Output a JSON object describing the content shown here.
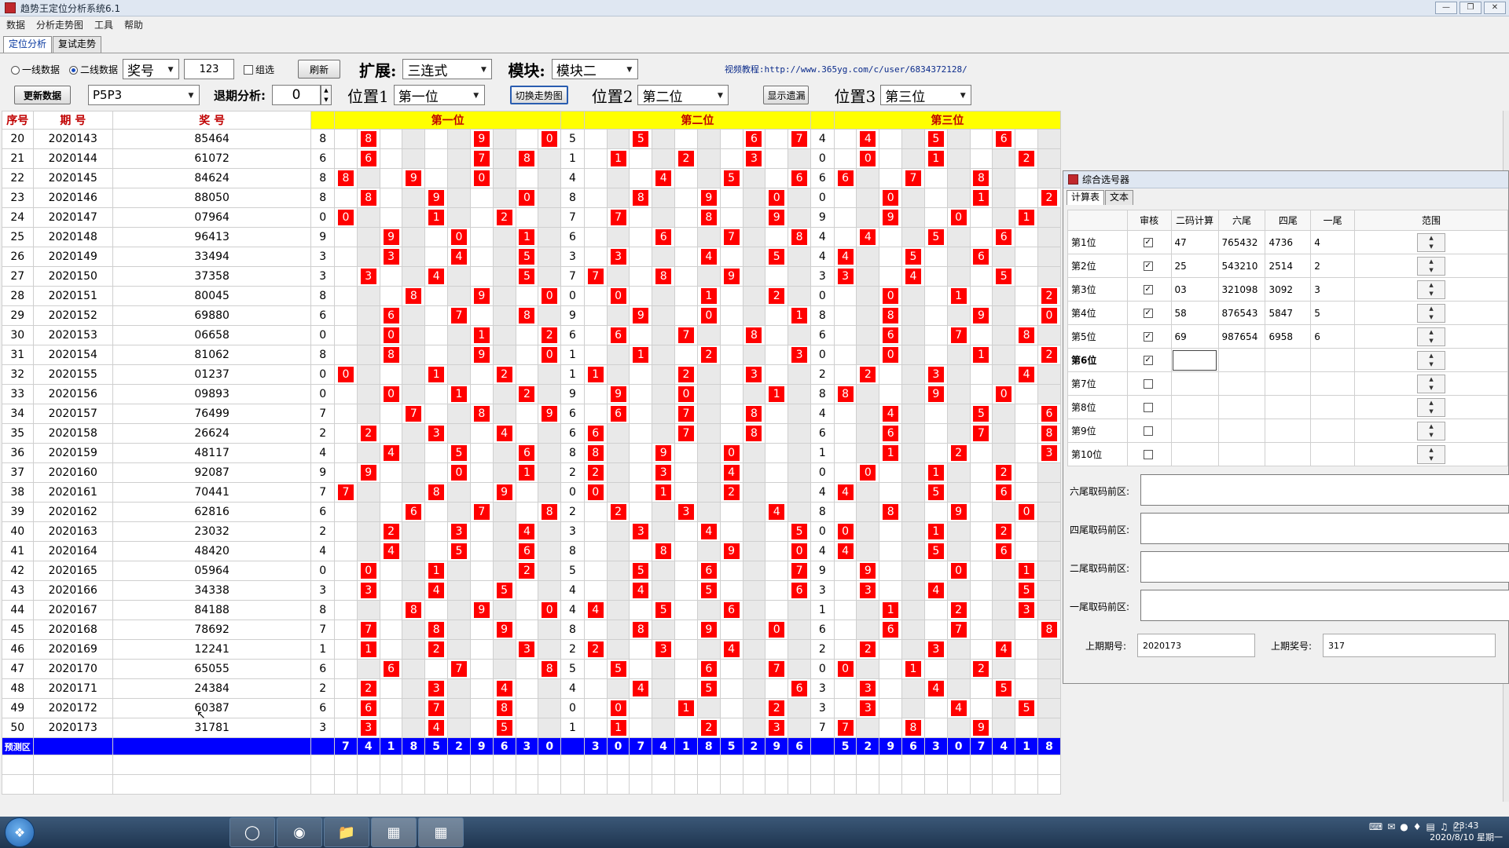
{
  "window": {
    "title": "趋势王定位分析系统6.1",
    "menu": [
      "数据",
      "分析走势图",
      "工具",
      "帮助"
    ],
    "tabs": [
      "定位分析",
      "复试走势"
    ]
  },
  "toolbar": {
    "radio1": "一线数据",
    "radio2": "二线数据",
    "field_select": "奖号",
    "number_input": "123",
    "group_check": "组选",
    "refresh": "刷新",
    "expand_label": "扩展:",
    "expand_value": "三连式",
    "module_label": "模块:",
    "module_value": "模块二",
    "video_label": "视频教程:",
    "video_url": "http://www.365yg.com/c/user/6834372128/",
    "update_btn": "更新数据",
    "lottery_select": "P5P3",
    "back_label": "退期分析:",
    "back_value": "0",
    "pos1_label": "位置1",
    "pos1_value": "第一位",
    "switch_btn": "切换走势图",
    "pos2_label": "位置2",
    "pos2_value": "第二位",
    "omit_btn": "显示遗漏",
    "pos3_label": "位置3",
    "pos3_value": "第三位"
  },
  "grid": {
    "headers": {
      "seq": "序号",
      "period": "期 号",
      "prize": "奖 号",
      "sec1": "第一位",
      "sec2": "第二位",
      "sec3": "第三位"
    },
    "rows": [
      {
        "seq": 20,
        "period": "2020143",
        "prize": "85464",
        "a": 8,
        "b": 5,
        "c": 4,
        "m1": [
          1,
          6,
          9
        ],
        "m2": [
          2,
          7,
          9
        ],
        "m3": [
          1,
          4,
          7
        ]
      },
      {
        "seq": 21,
        "period": "2020144",
        "prize": "61072",
        "a": 6,
        "b": 1,
        "c": 0,
        "m1": [
          1,
          6,
          8
        ],
        "m2": [
          1,
          4,
          7
        ],
        "m3": [
          1,
          4,
          8
        ]
      },
      {
        "seq": 22,
        "period": "2020145",
        "prize": "84624",
        "a": 8,
        "b": 4,
        "c": 6,
        "m1": [
          0,
          3,
          6
        ],
        "m2": [
          3,
          6,
          9
        ],
        "m3": [
          0,
          3,
          6
        ]
      },
      {
        "seq": 23,
        "period": "2020146",
        "prize": "88050",
        "a": 8,
        "b": 8,
        "c": 0,
        "m1": [
          1,
          4,
          8
        ],
        "m2": [
          2,
          5,
          8
        ],
        "m3": [
          2,
          6,
          9
        ]
      },
      {
        "seq": 24,
        "period": "2020147",
        "prize": "07964",
        "a": 0,
        "b": 7,
        "c": 9,
        "m1": [
          0,
          4,
          7
        ],
        "m2": [
          1,
          5,
          8
        ],
        "m3": [
          2,
          5,
          8
        ]
      },
      {
        "seq": 25,
        "period": "2020148",
        "prize": "96413",
        "a": 9,
        "b": 6,
        "c": 4,
        "m1": [
          2,
          5,
          8
        ],
        "m2": [
          3,
          6,
          9
        ],
        "m3": [
          1,
          4,
          7
        ]
      },
      {
        "seq": 26,
        "period": "2020149",
        "prize": "33494",
        "a": 3,
        "b": 3,
        "c": 4,
        "m1": [
          2,
          5,
          8
        ],
        "m2": [
          1,
          5,
          8
        ],
        "m3": [
          0,
          3,
          6
        ]
      },
      {
        "seq": 27,
        "period": "2020150",
        "prize": "37358",
        "a": 3,
        "b": 7,
        "c": 3,
        "m1": [
          1,
          4,
          8
        ],
        "m2": [
          0,
          3,
          6
        ],
        "m3": [
          0,
          3,
          7
        ]
      },
      {
        "seq": 28,
        "period": "2020151",
        "prize": "80045",
        "a": 8,
        "b": 0,
        "c": 0,
        "m1": [
          3,
          6,
          9
        ],
        "m2": [
          1,
          5,
          8
        ],
        "m3": [
          2,
          5,
          9
        ]
      },
      {
        "seq": 29,
        "period": "2020152",
        "prize": "69880",
        "a": 6,
        "b": 9,
        "c": 8,
        "m1": [
          2,
          5,
          8
        ],
        "m2": [
          2,
          5,
          9
        ],
        "m3": [
          2,
          6,
          9
        ]
      },
      {
        "seq": 30,
        "period": "2020153",
        "prize": "06658",
        "a": 0,
        "b": 6,
        "c": 6,
        "m1": [
          2,
          6,
          9
        ],
        "m2": [
          1,
          4,
          7
        ],
        "m3": [
          2,
          5,
          8
        ]
      },
      {
        "seq": 31,
        "period": "2020154",
        "prize": "81062",
        "a": 8,
        "b": 1,
        "c": 0,
        "m1": [
          2,
          6,
          9
        ],
        "m2": [
          2,
          5,
          9
        ],
        "m3": [
          2,
          6,
          9
        ]
      },
      {
        "seq": 32,
        "period": "2020155",
        "prize": "01237",
        "a": 0,
        "b": 1,
        "c": 2,
        "m1": [
          0,
          4,
          7
        ],
        "m2": [
          0,
          4,
          7
        ],
        "m3": [
          1,
          4,
          8
        ]
      },
      {
        "seq": 33,
        "period": "2020156",
        "prize": "09893",
        "a": 0,
        "b": 9,
        "c": 8,
        "m1": [
          2,
          5,
          8
        ],
        "m2": [
          1,
          4,
          8
        ],
        "m3": [
          0,
          4,
          7
        ]
      },
      {
        "seq": 34,
        "period": "2020157",
        "prize": "76499",
        "a": 7,
        "b": 6,
        "c": 4,
        "m1": [
          3,
          6,
          9
        ],
        "m2": [
          1,
          4,
          7
        ],
        "m3": [
          2,
          6,
          9
        ]
      },
      {
        "seq": 35,
        "period": "2020158",
        "prize": "26624",
        "a": 2,
        "b": 6,
        "c": 6,
        "m1": [
          1,
          4,
          7
        ],
        "m2": [
          0,
          4,
          7
        ],
        "m3": [
          2,
          6,
          9
        ]
      },
      {
        "seq": 36,
        "period": "2020159",
        "prize": "48117",
        "a": 4,
        "b": 8,
        "c": 1,
        "m1": [
          2,
          5,
          8
        ],
        "m2": [
          0,
          3,
          6
        ],
        "m3": [
          2,
          5,
          9
        ]
      },
      {
        "seq": 37,
        "period": "2020160",
        "prize": "92087",
        "a": 9,
        "b": 2,
        "c": 0,
        "m1": [
          1,
          5,
          8
        ],
        "m2": [
          0,
          3,
          6
        ],
        "m3": [
          1,
          4,
          7
        ]
      },
      {
        "seq": 38,
        "period": "2020161",
        "prize": "70441",
        "a": 7,
        "b": 0,
        "c": 4,
        "m1": [
          0,
          4,
          7
        ],
        "m2": [
          0,
          3,
          6
        ],
        "m3": [
          0,
          4,
          7
        ]
      },
      {
        "seq": 39,
        "period": "2020162",
        "prize": "62816",
        "a": 6,
        "b": 2,
        "c": 8,
        "m1": [
          3,
          6,
          9
        ],
        "m2": [
          1,
          4,
          8
        ],
        "m3": [
          2,
          5,
          8
        ]
      },
      {
        "seq": 40,
        "period": "2020163",
        "prize": "23032",
        "a": 2,
        "b": 3,
        "c": 0,
        "m1": [
          2,
          5,
          8
        ],
        "m2": [
          2,
          5,
          9
        ],
        "m3": [
          0,
          4,
          7
        ]
      },
      {
        "seq": 41,
        "period": "2020164",
        "prize": "48420",
        "a": 4,
        "b": 8,
        "c": 4,
        "m1": [
          2,
          5,
          8
        ],
        "m2": [
          3,
          6,
          9
        ],
        "m3": [
          0,
          4,
          7
        ]
      },
      {
        "seq": 42,
        "period": "2020165",
        "prize": "05964",
        "a": 0,
        "b": 5,
        "c": 9,
        "m1": [
          1,
          4,
          8
        ],
        "m2": [
          2,
          5,
          9
        ],
        "m3": [
          1,
          5,
          8
        ]
      },
      {
        "seq": 43,
        "period": "2020166",
        "prize": "34338",
        "a": 3,
        "b": 4,
        "c": 3,
        "m1": [
          1,
          4,
          7
        ],
        "m2": [
          2,
          5,
          9
        ],
        "m3": [
          1,
          4,
          8
        ]
      },
      {
        "seq": 44,
        "period": "2020167",
        "prize": "84188",
        "a": 8,
        "b": 4,
        "c": 1,
        "m1": [
          3,
          6,
          9
        ],
        "m2": [
          0,
          3,
          6
        ],
        "m3": [
          2,
          5,
          8
        ]
      },
      {
        "seq": 45,
        "period": "2020168",
        "prize": "78692",
        "a": 7,
        "b": 8,
        "c": 6,
        "m1": [
          1,
          4,
          7
        ],
        "m2": [
          2,
          5,
          8
        ],
        "m3": [
          2,
          5,
          9
        ]
      },
      {
        "seq": 46,
        "period": "2020169",
        "prize": "12241",
        "a": 1,
        "b": 2,
        "c": 2,
        "m1": [
          1,
          4,
          8
        ],
        "m2": [
          0,
          3,
          6
        ],
        "m3": [
          1,
          4,
          7
        ]
      },
      {
        "seq": 47,
        "period": "2020170",
        "prize": "65055",
        "a": 6,
        "b": 5,
        "c": 0,
        "m1": [
          2,
          5,
          9
        ],
        "m2": [
          1,
          5,
          8
        ],
        "m3": [
          0,
          3,
          6
        ]
      },
      {
        "seq": 48,
        "period": "2020171",
        "prize": "24384",
        "a": 2,
        "b": 4,
        "c": 3,
        "m1": [
          1,
          4,
          7
        ],
        "m2": [
          2,
          5,
          9
        ],
        "m3": [
          1,
          4,
          7
        ]
      },
      {
        "seq": 49,
        "period": "2020172",
        "prize": "60387",
        "a": 6,
        "b": 0,
        "c": 3,
        "m1": [
          1,
          4,
          7
        ],
        "m2": [
          1,
          4,
          8
        ],
        "m3": [
          1,
          5,
          8
        ]
      },
      {
        "seq": 50,
        "period": "2020173",
        "prize": "31781",
        "a": 3,
        "b": 1,
        "c": 7,
        "m1": [
          1,
          4,
          7
        ],
        "m2": [
          1,
          5,
          8
        ],
        "m3": [
          0,
          3,
          6
        ]
      }
    ],
    "pred_label": "预测区",
    "pred1": [
      7,
      4,
      1,
      8,
      5,
      2,
      9,
      6,
      3,
      0
    ],
    "pred2": [
      3,
      0,
      7,
      4,
      1,
      8,
      5,
      2,
      9,
      6
    ],
    "pred3": [
      5,
      2,
      9,
      6,
      3,
      0,
      7,
      4,
      1,
      8
    ]
  },
  "dialog": {
    "title": "综合选号器",
    "tabs": [
      "计算表",
      "文本"
    ],
    "headers": [
      "审核",
      "二码计算",
      "六尾",
      "四尾",
      "一尾",
      "范围"
    ],
    "rows": [
      {
        "label": "第1位",
        "checked": true,
        "a": "47",
        "b": "765432",
        "c": "4736",
        "d": "4"
      },
      {
        "label": "第2位",
        "checked": true,
        "a": "25",
        "b": "543210",
        "c": "2514",
        "d": "2"
      },
      {
        "label": "第3位",
        "checked": true,
        "a": "03",
        "b": "321098",
        "c": "3092",
        "d": "3"
      },
      {
        "label": "第4位",
        "checked": true,
        "a": "58",
        "b": "876543",
        "c": "5847",
        "d": "5"
      },
      {
        "label": "第5位",
        "checked": true,
        "a": "69",
        "b": "987654",
        "c": "6958",
        "d": "6"
      },
      {
        "label": "第6位",
        "checked": true,
        "a": "",
        "b": "",
        "c": "",
        "d": ""
      },
      {
        "label": "第7位",
        "checked": false,
        "a": "",
        "b": "",
        "c": "",
        "d": ""
      },
      {
        "label": "第8位",
        "checked": false,
        "a": "",
        "b": "",
        "c": "",
        "d": ""
      },
      {
        "label": "第9位",
        "checked": false,
        "a": "",
        "b": "",
        "c": "",
        "d": ""
      },
      {
        "label": "第10位",
        "checked": false,
        "a": "",
        "b": "",
        "c": "",
        "d": ""
      }
    ],
    "areas": [
      "六尾取码前区:",
      "四尾取码前区:",
      "二尾取码前区:",
      "一尾取码前区:"
    ],
    "last_period_label": "上期期号:",
    "last_period": "2020173",
    "last_prize_label": "上期奖号:",
    "last_prize": "317"
  },
  "taskbar": {
    "time": "23:43",
    "date": "2020/8/10 星期一"
  }
}
